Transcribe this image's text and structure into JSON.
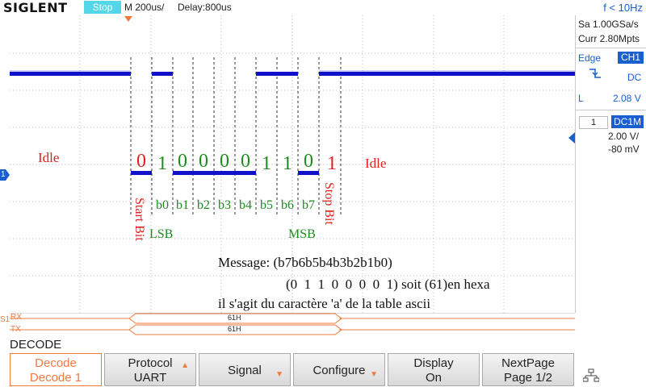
{
  "topbar": {
    "brand": "SIGLENT",
    "run_state": "Stop",
    "timebase": "M 200us/",
    "delay": "Delay:800us",
    "frequency": "f < 10Hz"
  },
  "side_panel": {
    "sample_rate": "Sa 1.00GSa/s",
    "memory_depth": "Curr 2.80Mpts",
    "trigger_type": "Edge",
    "trigger_source": "CH1",
    "trigger_slope_icon": "falling-edge-icon",
    "trigger_coupling": "DC",
    "trigger_level_label": "L",
    "trigger_level": "2.08 V",
    "channel_number": "1",
    "channel_coupling": "DC1M",
    "channel_scale": "2.00 V/",
    "channel_offset": "-80 mV"
  },
  "waveform": {
    "channel_marker": "1",
    "bits": [
      "0",
      "1",
      "0",
      "0",
      "0",
      "0",
      "1",
      "1",
      "0",
      "1"
    ],
    "bit_labels": [
      "b0",
      "b1",
      "b2",
      "b3",
      "b4",
      "b5",
      "b6",
      "b7"
    ],
    "idle_left": "Idle",
    "idle_right": "Idle",
    "start_bit": "Start Bit",
    "stop_bit": "Stop Bit",
    "lsb": "LSB",
    "msb": "MSB",
    "message_line1": "Message: (b7b6b5b4b3b2b1b0)",
    "message_line2": "(0  1  1  0  0  0  0  1) soit (61)en hexa",
    "message_line3": "il s'agit du caractère 'a' de la table ascii"
  },
  "bus": {
    "serial_label": "S1",
    "rx_label": "RX",
    "tx_label": "TX",
    "rx_value": "61H",
    "tx_value": "61H"
  },
  "decode_title": "DECODE",
  "softkeys": [
    {
      "line1": "Decode",
      "line2": "Decode 1"
    },
    {
      "line1": "Protocol",
      "line2": "UART"
    },
    {
      "line1": "Signal",
      "line2": ""
    },
    {
      "line1": "Configure",
      "line2": ""
    },
    {
      "line1": "Display",
      "line2": "On"
    },
    {
      "line1": "NextPage",
      "line2": "Page 1/2"
    }
  ],
  "colors": {
    "accent_orange": "#f07a3c",
    "trace_blue": "#1010c8",
    "label_red": "#e02020",
    "label_green": "#1c8a1c",
    "badge_blue": "#1a5fd0",
    "stop_cyan": "#53d7e8"
  }
}
